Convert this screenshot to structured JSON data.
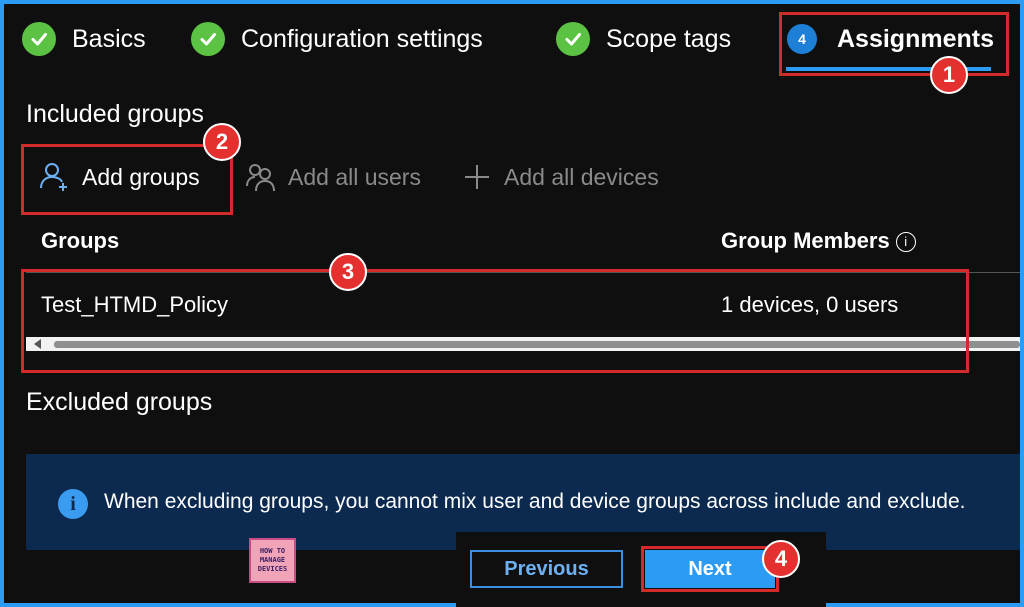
{
  "wizard": {
    "steps": [
      {
        "label": "Basics",
        "state": "complete"
      },
      {
        "label": "Configuration settings",
        "state": "complete"
      },
      {
        "label": "Scope tags",
        "state": "complete"
      },
      {
        "number": "4",
        "label": "Assignments",
        "state": "active"
      }
    ]
  },
  "included": {
    "heading": "Included groups",
    "commands": {
      "add_groups": "Add groups",
      "add_all_users": "Add all users",
      "add_all_devices": "Add all devices"
    },
    "table": {
      "columns": [
        "Groups",
        "Group Members"
      ],
      "rows": [
        {
          "group": "Test_HTMD_Policy",
          "members": "1 devices, 0 users"
        }
      ]
    }
  },
  "excluded": {
    "heading": "Excluded groups",
    "info_text": "When excluding groups, you cannot mix user and device groups across include and exclude."
  },
  "footer": {
    "previous_label": "Previous",
    "next_label": "Next",
    "logo_lines": [
      "HOW TO",
      "MANAGE",
      "DEVICES"
    ]
  },
  "annotations": [
    "1",
    "2",
    "3",
    "4"
  ],
  "colors": {
    "accent": "#2b9bf4",
    "complete_check": "#5cc243",
    "highlight_box": "#d42a2a",
    "info_bar": "#0c2a50"
  }
}
